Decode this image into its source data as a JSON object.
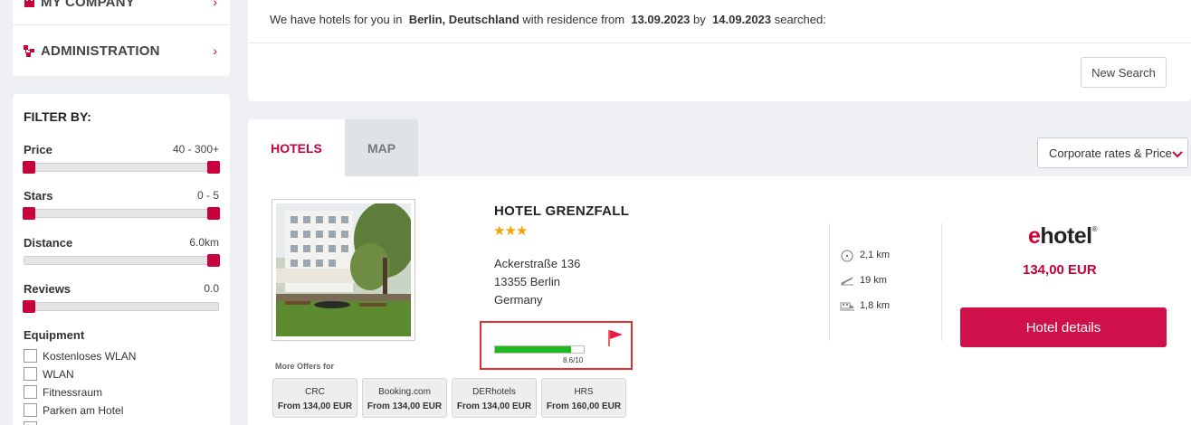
{
  "sidebar": {
    "nav": [
      {
        "label": "MY COMPANY",
        "icon": "building-icon"
      },
      {
        "label": "ADMINISTRATION",
        "icon": "org-chart-icon"
      }
    ],
    "filter": {
      "title": "FILTER BY:",
      "price": {
        "label": "Price",
        "value": "40 - 300+",
        "low": 0.0,
        "high": 1.0
      },
      "stars": {
        "label": "Stars",
        "value": "0 - 5",
        "low": 0.0,
        "high": 1.0
      },
      "distance": {
        "label": "Distance",
        "value": "6.0km",
        "level": 1.0
      },
      "reviews": {
        "label": "Reviews",
        "value": "0.0",
        "level": 0.0
      },
      "equipment_title": "Equipment",
      "equipment": [
        "Kostenloses WLAN",
        "WLAN",
        "Fitnessraum",
        "Parken am Hotel"
      ]
    }
  },
  "search_info": {
    "prefix": "We have hotels for you in",
    "location": "Berlin, Deutschland",
    "residence_from": "with residence from",
    "date_from": "13.09.2023",
    "by": "by",
    "date_to": "14.09.2023",
    "suffix": "searched:",
    "new_search_label": "New Search"
  },
  "tabs": {
    "hotels": "HOTELS",
    "map": "MAP",
    "active": "hotels"
  },
  "sort": {
    "selected": "Corporate rates & Price"
  },
  "hotel": {
    "name": "HOTEL GRENZFALL",
    "stars": "★★★",
    "address_line1": "Ackerstraße 136",
    "address_line2": "13355 Berlin",
    "address_line3": "Germany",
    "rating_score": "8.6/10",
    "rating_fraction": 0.86,
    "more_offers_label": "More Offers for",
    "offers": [
      {
        "provider": "CRC",
        "price": "From 134,00 EUR"
      },
      {
        "provider": "Booking.com",
        "price": "From 134,00 EUR"
      },
      {
        "provider": "DERhotels",
        "price": "From 134,00 EUR"
      },
      {
        "provider": "HRS",
        "price": "From 160,00 EUR"
      }
    ],
    "distances": [
      {
        "icon": "center-target-icon",
        "value": "2,1 km"
      },
      {
        "icon": "airplane-icon",
        "value": "19 km"
      },
      {
        "icon": "train-icon",
        "value": "1,8 km"
      }
    ],
    "brand": {
      "e": "e",
      "rest": "hotel",
      "mark": "®"
    },
    "price": "134,00 EUR",
    "details_label": "Hotel details"
  },
  "colors": {
    "accent": "#c8003c",
    "rating_green": "#1db91d",
    "highlight_red": "#e03030",
    "star": "#f5a300"
  }
}
